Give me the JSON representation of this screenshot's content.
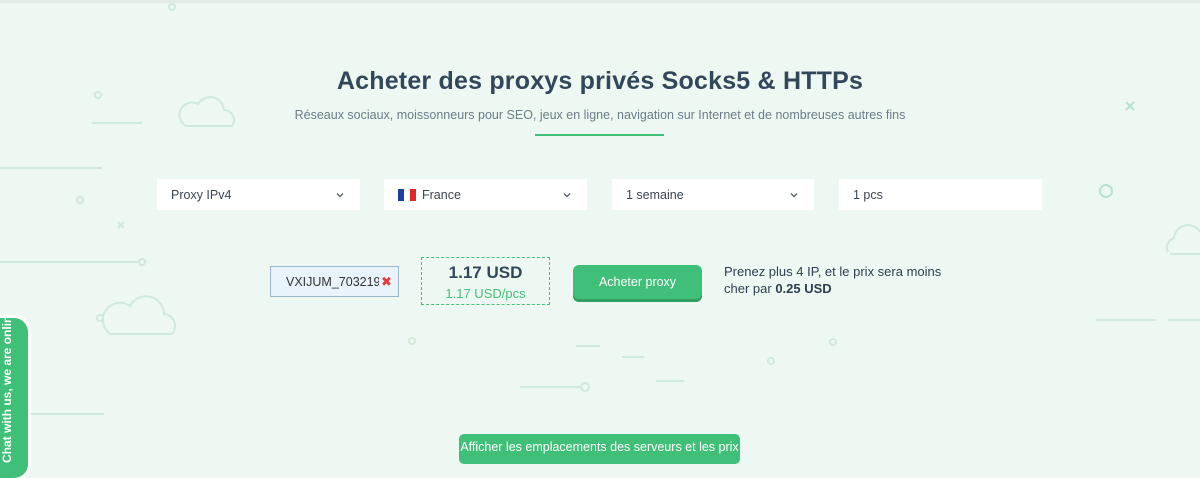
{
  "header": {
    "title": "Acheter des proxys privés Socks5 & HTTPs",
    "subtitle": "Réseaux sociaux, moissonneurs pour SEO, jeux en ligne, navigation sur Internet et de nombreuses autres fins"
  },
  "filters": {
    "proxy_type": "Proxy IPv4",
    "country": "France",
    "period": "1 semaine",
    "quantity": "1 pcs"
  },
  "order": {
    "coupon_code": "VXIJUM_703219",
    "coupon_remove_icon": "close-icon",
    "price_total": "1.17 USD",
    "price_per_unit": "1.17 USD/pcs",
    "buy_label": "Acheter proxy",
    "promo_text": "Prenez plus 4 IP, et le prix sera moins cher par ",
    "promo_amount": "0.25 USD"
  },
  "bottom_button": {
    "label": "Afficher les emplacements des serveurs et les prix"
  },
  "chat": {
    "label": "Chat with us, we are online!"
  },
  "colors": {
    "accent": "#3fbf78",
    "background": "#eef8f2",
    "title": "#33475b"
  },
  "icons": [
    "chevron-down-icon",
    "france-flag-icon",
    "close-icon",
    "cloud-icon"
  ]
}
